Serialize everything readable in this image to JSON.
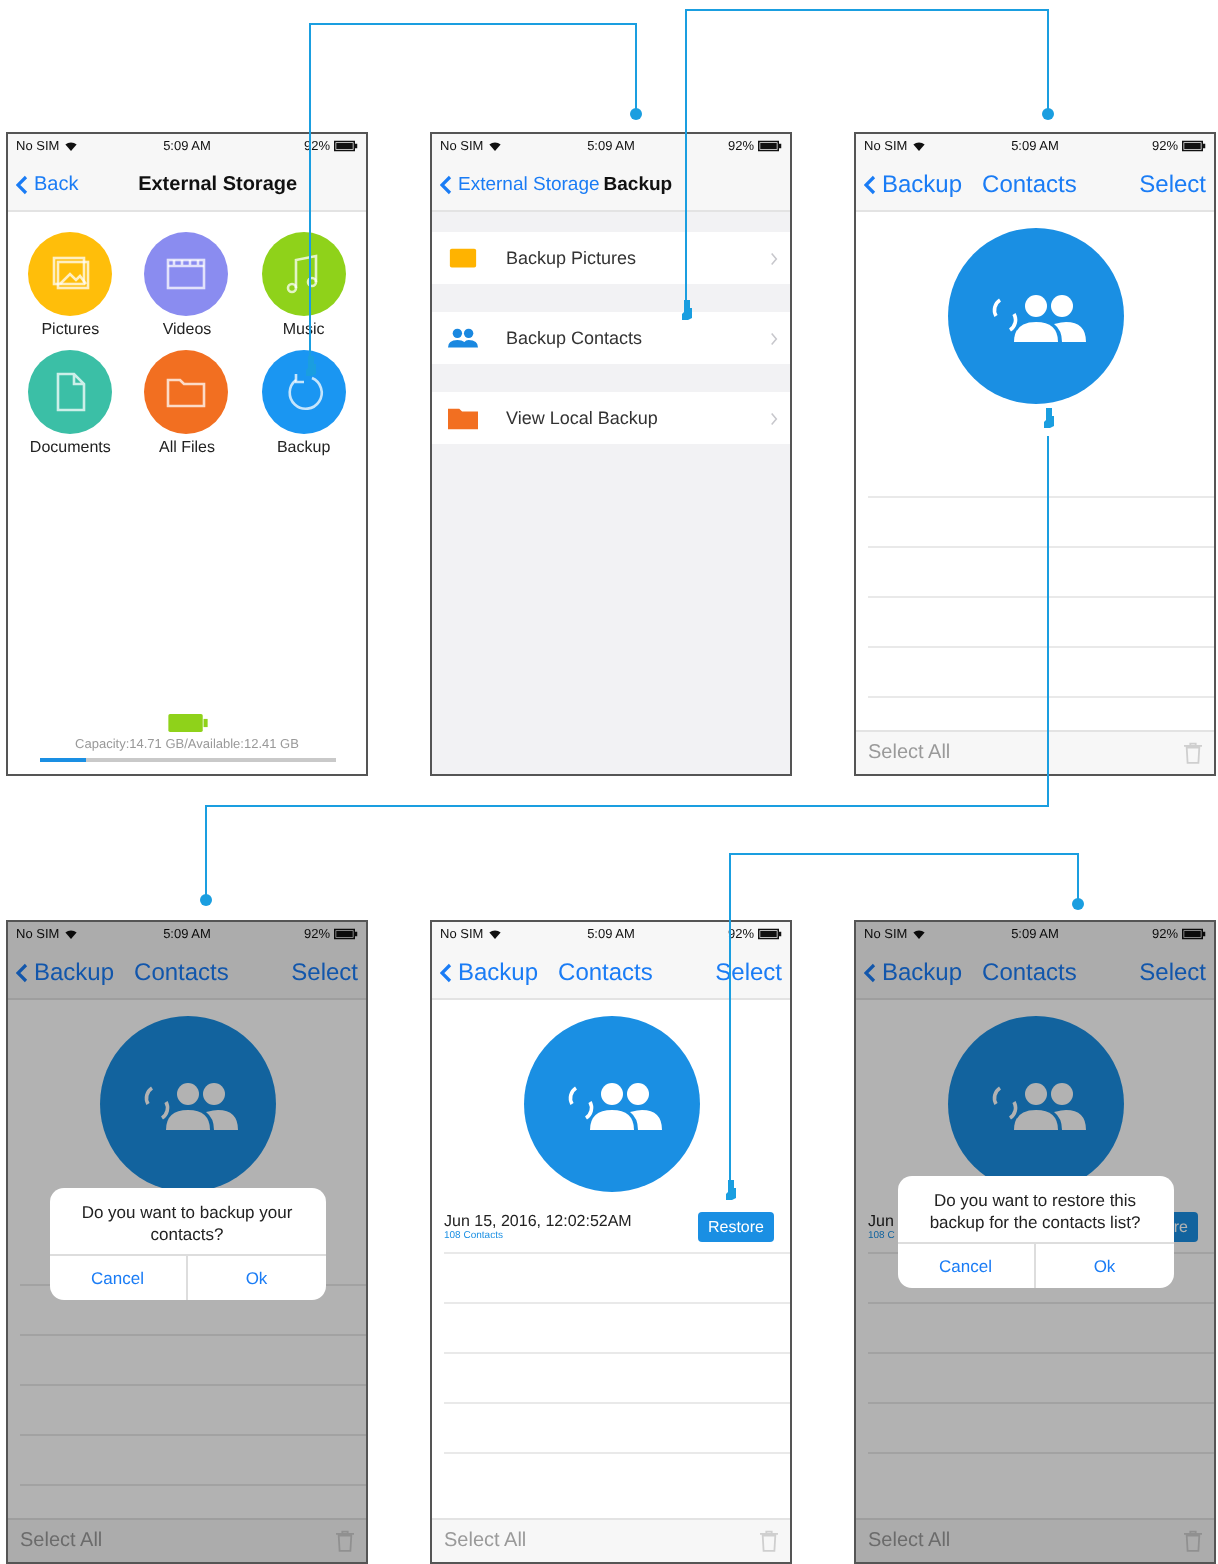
{
  "screens": [
    {
      "kind": "storage",
      "status": {
        "carrier": "No SIM",
        "time": "5:09 AM",
        "battery": "92%"
      },
      "nav": {
        "back": "Back",
        "title": "External Storage"
      },
      "tiles": [
        {
          "label": "Pictures",
          "color": "#ffbe0a"
        },
        {
          "label": "Videos",
          "color": "#8a8cf0"
        },
        {
          "label": "Music",
          "color": "#8fd21a"
        },
        {
          "label": "Documents",
          "color": "#3bbfa6"
        },
        {
          "label": "All Files",
          "color": "#f26f21"
        },
        {
          "label": "Backup",
          "color": "#1a96f2"
        }
      ],
      "capacity": "Capacity:14.71 GB/Available:12.41 GB",
      "usage": {
        "level": 0.16
      }
    },
    {
      "kind": "menu",
      "status": {
        "carrier": "No SIM",
        "time": "5:09 AM",
        "battery": "92%"
      },
      "nav": {
        "back": "External Storage",
        "title": "Backup"
      },
      "items": [
        {
          "label": "Backup Pictures",
          "color": "#ffb300"
        },
        {
          "label": "Backup Contacts",
          "color": "#1a88e0"
        },
        {
          "label": "View Local Backup",
          "color": "#f26f21"
        }
      ]
    },
    {
      "kind": "contacts",
      "dimmed": false,
      "status": {
        "carrier": "No SIM",
        "time": "5:09 AM",
        "battery": "92%"
      },
      "nav": {
        "back": "Backup",
        "title": "Contacts",
        "action": "Select"
      },
      "toolbar": {
        "select_all": "Select All"
      }
    },
    {
      "kind": "contacts",
      "dimmed": true,
      "status": {
        "carrier": "No SIM",
        "time": "5:09 AM",
        "battery": "92%"
      },
      "nav": {
        "back": "Backup",
        "title": "Contacts",
        "action": "Select"
      },
      "toolbar": {
        "select_all": "Select All"
      },
      "dialog": {
        "message": "Do you want to backup your contacts?",
        "cancel": "Cancel",
        "ok": "Ok"
      }
    },
    {
      "kind": "contacts",
      "dimmed": false,
      "status": {
        "carrier": "No SIM",
        "time": "5:09 AM",
        "battery": "92%"
      },
      "nav": {
        "back": "Backup",
        "title": "Contacts",
        "action": "Select"
      },
      "toolbar": {
        "select_all": "Select All"
      },
      "backup": {
        "date": "Jun 15, 2016, 12:02:52AM",
        "count": "108 Contacts",
        "button": "Restore"
      }
    },
    {
      "kind": "contacts",
      "dimmed": true,
      "status": {
        "carrier": "No SIM",
        "time": "5:09 AM",
        "battery": "92%"
      },
      "nav": {
        "back": "Backup",
        "title": "Contacts",
        "action": "Select"
      },
      "toolbar": {
        "select_all": "Select All"
      },
      "backup": {
        "date": "Jun",
        "count": "108 C",
        "button": "re"
      },
      "dialog": {
        "message": "Do you want to restore this backup for the contacts list?",
        "cancel": "Cancel",
        "ok": "Ok"
      }
    }
  ]
}
